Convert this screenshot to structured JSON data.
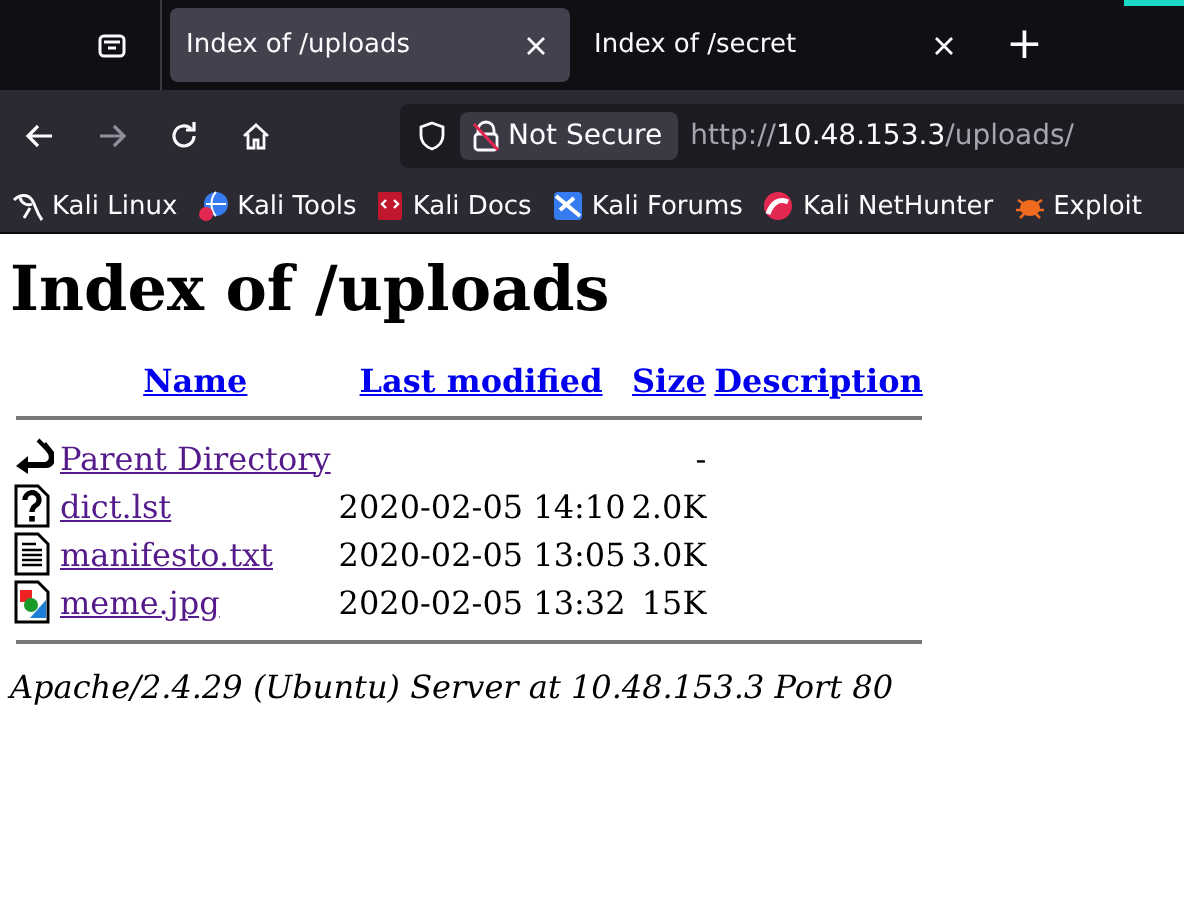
{
  "tabs": [
    {
      "title": "Index of /uploads",
      "selected": true
    },
    {
      "title": "Index of /secret",
      "selected": false
    }
  ],
  "new_tab": "+",
  "address_bar": {
    "security": "Not Secure",
    "url_scheme": "http://",
    "url_host": "10.48.153.3",
    "url_path": "/uploads/"
  },
  "bookmarks": [
    {
      "label": "Kali Linux",
      "kind": "dragon"
    },
    {
      "label": "Kali Tools",
      "kind": "tools"
    },
    {
      "label": "Kali Docs",
      "kind": "docs"
    },
    {
      "label": "Kali Forums",
      "kind": "forums"
    },
    {
      "label": "Kali NetHunter",
      "kind": "nethunter"
    },
    {
      "label": "Exploit",
      "kind": "exploit"
    }
  ],
  "page": {
    "heading": "Index of /uploads",
    "columns": [
      "Name",
      "Last modified",
      "Size",
      "Description"
    ],
    "rows": [
      {
        "kind": "back",
        "name": "Parent Directory",
        "modified": "",
        "size": "-"
      },
      {
        "kind": "unknown",
        "name": "dict.lst",
        "modified": "2020-02-05 14:10",
        "size": "2.0K"
      },
      {
        "kind": "text",
        "name": "manifesto.txt",
        "modified": "2020-02-05 13:05",
        "size": "3.0K"
      },
      {
        "kind": "image",
        "name": "meme.jpg",
        "modified": "2020-02-05 13:32",
        "size": "15K"
      }
    ],
    "footer": "Apache/2.4.29 (Ubuntu) Server at 10.48.153.3 Port 80"
  }
}
